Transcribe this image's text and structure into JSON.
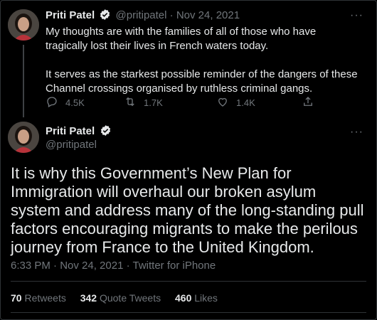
{
  "tweet1": {
    "name": "Priti Patel",
    "handle": "@pritipatel",
    "separator": "·",
    "date": "Nov 24, 2021",
    "text": "My thoughts are with the families of all of those who have tragically lost their lives in French waters today.\n\nIt serves as the starkest possible reminder of the dangers of these Channel crossings organised by ruthless criminal gangs.",
    "replies": "4.5K",
    "retweets": "1.7K",
    "likes": "1.4K",
    "more": "···"
  },
  "tweet2": {
    "name": "Priti Patel",
    "handle": "@pritipatel",
    "more": "···",
    "text": "It is why this Government’s New Plan for Immigration will overhaul our broken asylum system and address many of the long-standing pull factors encouraging migrants to make the perilous journey from France to the United Kingdom.",
    "meta": "6:33 PM · Nov 24, 2021 · Twitter for iPhone",
    "stats": {
      "retweets_count": "70",
      "retweets_label": "Retweets",
      "quotes_count": "342",
      "quotes_label": "Quote Tweets",
      "likes_count": "460",
      "likes_label": "Likes"
    }
  },
  "colors": {
    "background": "#000000",
    "text": "#e7e9ea",
    "muted": "#71767b",
    "verified": "#e7e9ea"
  },
  "icons": [
    "avatar",
    "verified-icon",
    "reply-icon",
    "retweet-icon",
    "like-icon",
    "share-icon",
    "more-icon"
  ]
}
